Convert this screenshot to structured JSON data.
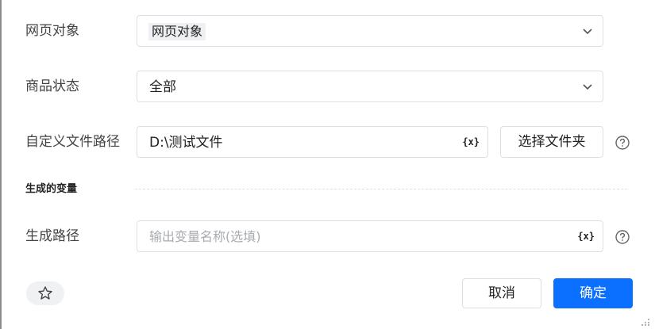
{
  "form": {
    "web_object": {
      "label": "网页对象",
      "value": "网页对象"
    },
    "product_status": {
      "label": "商品状态",
      "value": "全部"
    },
    "custom_path": {
      "label": "自定义文件路径",
      "value": "D:\\测试文件",
      "select_folder_label": "选择文件夹"
    },
    "section_title": "生成的变量",
    "generated_path": {
      "label": "生成路径",
      "placeholder": "输出变量名称(选填)"
    }
  },
  "icons": {
    "variable_icon_text": "{x}"
  },
  "footer": {
    "cancel_label": "取消",
    "confirm_label": "确定"
  },
  "colors": {
    "primary": "#0b6fff",
    "border": "#dcdfe6",
    "placeholder": "#a8abb2"
  }
}
